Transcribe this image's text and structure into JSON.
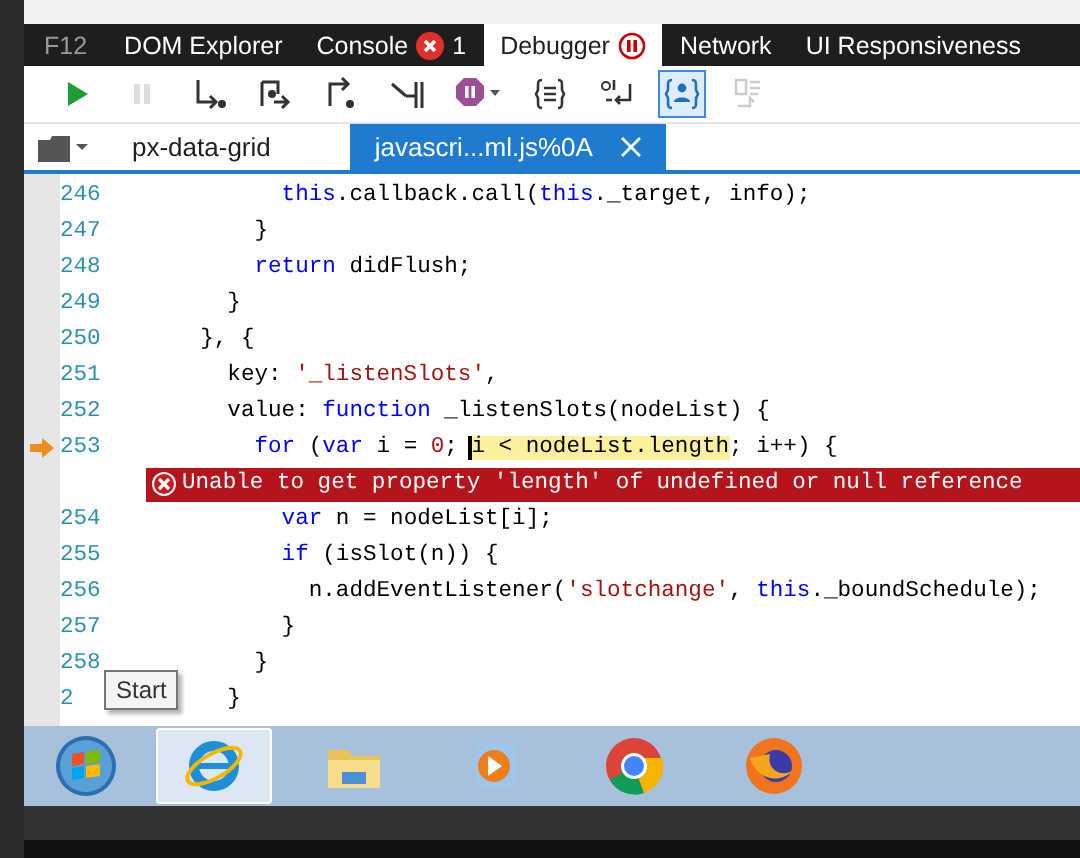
{
  "tab_bar": {
    "caption": "F12",
    "tabs": [
      {
        "label": "DOM Explorer",
        "selected": false
      },
      {
        "label": "Console",
        "selected": false,
        "error_count": "1"
      },
      {
        "label": "Debugger",
        "selected": true,
        "paused": true
      },
      {
        "label": "Network",
        "selected": false
      },
      {
        "label": "UI Responsiveness",
        "selected": false
      }
    ]
  },
  "toolbar": {
    "buttons": [
      {
        "kind": "continue",
        "disabled": false,
        "selected": false
      },
      {
        "kind": "pause",
        "disabled": true,
        "selected": false
      },
      {
        "kind": "step-into",
        "disabled": false,
        "selected": false
      },
      {
        "kind": "step-over",
        "disabled": false,
        "selected": false
      },
      {
        "kind": "step-out",
        "disabled": false,
        "selected": false
      },
      {
        "kind": "break-on-worker",
        "disabled": false,
        "selected": false
      },
      {
        "kind": "break-on-exceptions",
        "disabled": false,
        "selected": false
      },
      {
        "kind": "pretty-print",
        "disabled": false,
        "selected": false
      },
      {
        "kind": "word-wrap",
        "disabled": false,
        "selected": false
      },
      {
        "kind": "just-my-code",
        "disabled": false,
        "selected": true
      },
      {
        "kind": "source-maps",
        "disabled": true,
        "selected": false
      }
    ]
  },
  "file_tabs": [
    {
      "label": "px-data-grid",
      "selected": false,
      "closable": false
    },
    {
      "label": "javascri...ml.js%0A",
      "selected": true,
      "closable": true
    }
  ],
  "code": {
    "lines": [
      {
        "kind": "code",
        "number": "246",
        "current": false,
        "tokens": [
          {
            "kind": "keyword",
            "text": "          this"
          },
          {
            "kind": "plain",
            "text": ".callback.call("
          },
          {
            "kind": "keyword",
            "text": "this"
          },
          {
            "kind": "plain",
            "text": "._target, info);"
          }
        ]
      },
      {
        "kind": "code",
        "number": "247",
        "current": false,
        "tokens": [
          {
            "kind": "plain",
            "text": "        }"
          }
        ]
      },
      {
        "kind": "code",
        "number": "248",
        "current": false,
        "tokens": [
          {
            "kind": "keyword",
            "text": "        return"
          },
          {
            "kind": "plain",
            "text": " didFlush;"
          }
        ]
      },
      {
        "kind": "code",
        "number": "249",
        "current": false,
        "tokens": [
          {
            "kind": "plain",
            "text": "      }"
          }
        ]
      },
      {
        "kind": "code",
        "number": "250",
        "current": false,
        "tokens": [
          {
            "kind": "plain",
            "text": "    }, {"
          }
        ]
      },
      {
        "kind": "code",
        "number": "251",
        "current": false,
        "tokens": [
          {
            "kind": "plain",
            "text": "      key: "
          },
          {
            "kind": "string",
            "text": "'_listenSlots'"
          },
          {
            "kind": "plain",
            "text": ","
          }
        ]
      },
      {
        "kind": "code",
        "number": "252",
        "current": false,
        "tokens": [
          {
            "kind": "plain",
            "text": "      value: "
          },
          {
            "kind": "keyword",
            "text": "function"
          },
          {
            "kind": "plain",
            "text": " _listenSlots(nodeList) {"
          }
        ]
      },
      {
        "kind": "code",
        "number": "253",
        "current": true,
        "tokens": [
          {
            "kind": "keyword",
            "text": "        for"
          },
          {
            "kind": "plain",
            "text": " ("
          },
          {
            "kind": "keyword",
            "text": "var"
          },
          {
            "kind": "plain",
            "text": " i = "
          },
          {
            "kind": "number",
            "text": "0"
          },
          {
            "kind": "plain",
            "text": "; "
          },
          {
            "kind": "highlight",
            "text": "i < nodeList.length"
          },
          {
            "kind": "plain",
            "text": "; i++) {"
          }
        ]
      },
      {
        "kind": "error",
        "message": "Unable to get property 'length' of undefined or null reference"
      },
      {
        "kind": "code",
        "number": "254",
        "current": false,
        "tokens": [
          {
            "kind": "keyword",
            "text": "          var"
          },
          {
            "kind": "plain",
            "text": " n = nodeList[i];"
          }
        ]
      },
      {
        "kind": "code",
        "number": "255",
        "current": false,
        "tokens": [
          {
            "kind": "keyword",
            "text": "          if"
          },
          {
            "kind": "plain",
            "text": " (isSlot(n)) {"
          }
        ]
      },
      {
        "kind": "code",
        "number": "256",
        "current": false,
        "tokens": [
          {
            "kind": "plain",
            "text": "            n.addEventListener("
          },
          {
            "kind": "string",
            "text": "'slotchange'"
          },
          {
            "kind": "plain",
            "text": ", "
          },
          {
            "kind": "keyword",
            "text": "this"
          },
          {
            "kind": "plain",
            "text": "._boundSchedule);"
          }
        ]
      },
      {
        "kind": "code",
        "number": "257",
        "current": false,
        "tokens": [
          {
            "kind": "plain",
            "text": "          }"
          }
        ]
      },
      {
        "kind": "code",
        "number": "258",
        "current": false,
        "tokens": [
          {
            "kind": "plain",
            "text": "        }"
          }
        ]
      },
      {
        "kind": "code",
        "number": "2",
        "current": false,
        "tokens": [
          {
            "kind": "plain",
            "text": "      }"
          }
        ]
      }
    ]
  },
  "taskbar": {
    "tooltip": "Start",
    "items": [
      {
        "kind": "start",
        "selected": false
      },
      {
        "kind": "ie",
        "selected": true
      },
      {
        "kind": "explorer",
        "selected": false
      },
      {
        "kind": "media",
        "selected": false
      },
      {
        "kind": "chrome",
        "selected": false
      },
      {
        "kind": "firefox",
        "selected": false
      }
    ]
  }
}
